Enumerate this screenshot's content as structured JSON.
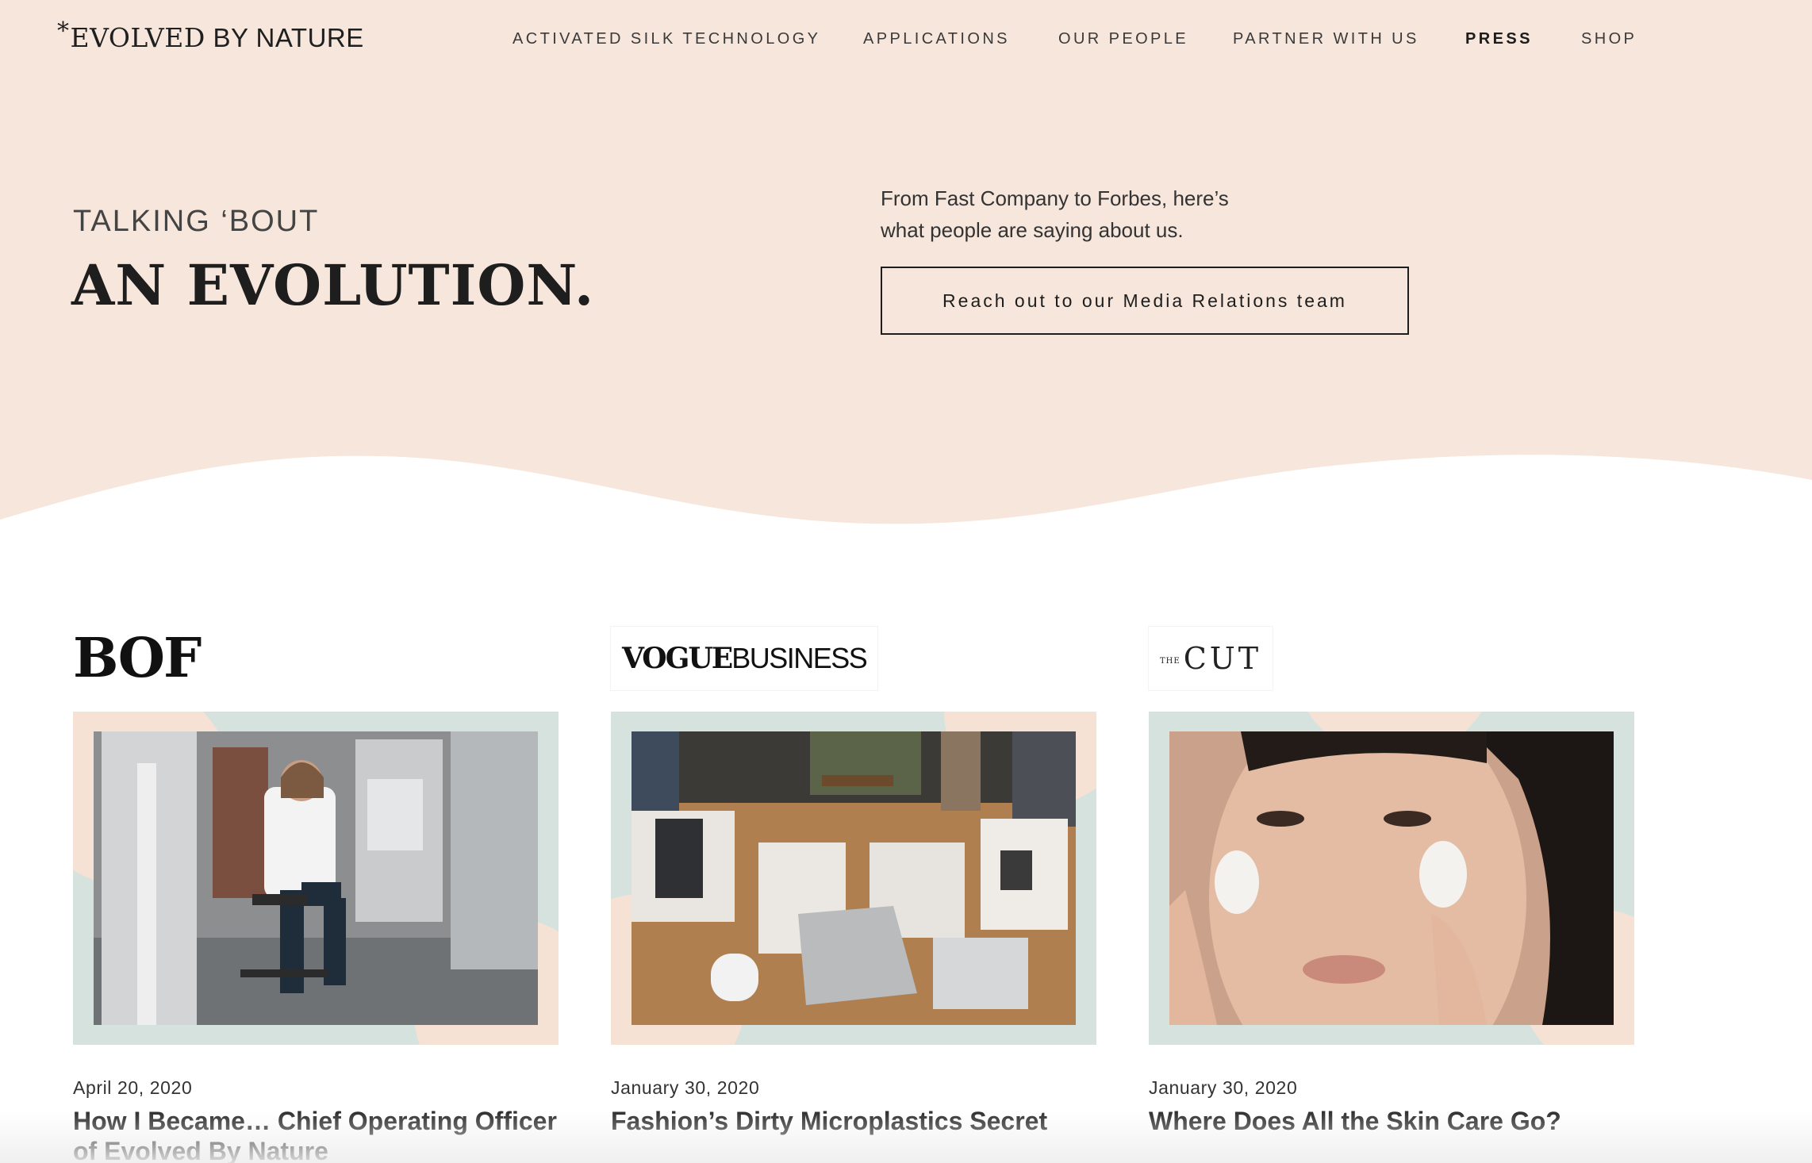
{
  "brand": {
    "asterisk": "*",
    "name_bold": "EVOLVED",
    "name_light": " BY NATURE"
  },
  "nav": {
    "items": [
      {
        "label": "ACTIVATED SILK TECHNOLOGY"
      },
      {
        "label": "APPLICATIONS"
      },
      {
        "label": "OUR PEOPLE"
      },
      {
        "label": "PARTNER WITH US"
      },
      {
        "label": "PRESS"
      },
      {
        "label": "SHOP"
      }
    ],
    "active": "PRESS"
  },
  "hero": {
    "eyebrow": "TALKING ‘BOUT",
    "headline": "AN EVOLUTION.",
    "intro_line1": "From Fast Company to Forbes, here’s",
    "intro_line2": "what people are saying about us.",
    "cta_label": "Reach out to our Media Relations team"
  },
  "press": [
    {
      "publication": "BOF",
      "date": "April 20, 2020",
      "title": "How I Became… Chief Operating Officer of Evolved By Nature"
    },
    {
      "publication_a": "VOGUE",
      "publication_b": "BUSINESS",
      "date": "January 30, 2020",
      "title": "Fashion’s Dirty Microplastics Secret"
    },
    {
      "publication_small": "THE",
      "publication": "CUT",
      "date": "January 30, 2020",
      "title": "Where Does All the Skin Care Go?"
    }
  ],
  "colors": {
    "hero_bg": "#f6e6db",
    "frame_mint": "#d6e2dd",
    "frame_peach": "#f6e2d5",
    "text_dark": "#1e1e1e"
  },
  "icons": [
    "asterisk-icon"
  ]
}
